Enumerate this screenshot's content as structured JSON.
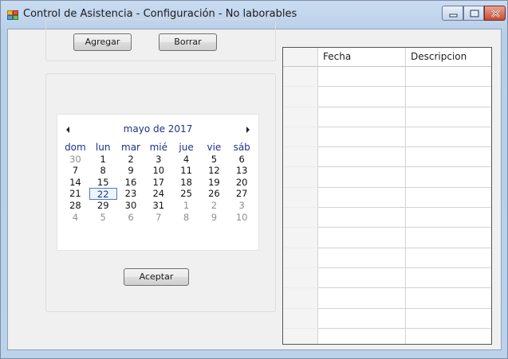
{
  "window": {
    "title": "Control de Asistencia - Configuración - No laborables",
    "icon": "form-icon",
    "controls": [
      "minimize-icon",
      "maximize-icon",
      "close-icon"
    ]
  },
  "toolbar": {
    "add_label": "Agregar",
    "delete_label": "Borrar"
  },
  "calendar": {
    "month_title": "mayo de 2017",
    "days_of_week": [
      "dom",
      "lun",
      "mar",
      "mié",
      "jue",
      "vie",
      "sáb"
    ],
    "weeks": [
      [
        {
          "d": "30",
          "other": true
        },
        {
          "d": "1"
        },
        {
          "d": "2"
        },
        {
          "d": "3"
        },
        {
          "d": "4"
        },
        {
          "d": "5"
        },
        {
          "d": "6"
        }
      ],
      [
        {
          "d": "7"
        },
        {
          "d": "8"
        },
        {
          "d": "9"
        },
        {
          "d": "10"
        },
        {
          "d": "11"
        },
        {
          "d": "12"
        },
        {
          "d": "13"
        }
      ],
      [
        {
          "d": "14"
        },
        {
          "d": "15"
        },
        {
          "d": "16"
        },
        {
          "d": "17"
        },
        {
          "d": "18"
        },
        {
          "d": "19"
        },
        {
          "d": "20"
        }
      ],
      [
        {
          "d": "21"
        },
        {
          "d": "22",
          "today": true
        },
        {
          "d": "23"
        },
        {
          "d": "24"
        },
        {
          "d": "25"
        },
        {
          "d": "26"
        },
        {
          "d": "27"
        }
      ],
      [
        {
          "d": "28"
        },
        {
          "d": "29"
        },
        {
          "d": "30"
        },
        {
          "d": "31"
        },
        {
          "d": "1",
          "other": true
        },
        {
          "d": "2",
          "other": true
        },
        {
          "d": "3",
          "other": true
        }
      ],
      [
        {
          "d": "4",
          "other": true
        },
        {
          "d": "5",
          "other": true
        },
        {
          "d": "6",
          "other": true
        },
        {
          "d": "7",
          "other": true
        },
        {
          "d": "8",
          "other": true
        },
        {
          "d": "9",
          "other": true
        },
        {
          "d": "10",
          "other": true
        }
      ]
    ],
    "today_day": "22",
    "accept_label": "Aceptar"
  },
  "grid": {
    "columns": [
      "Fecha",
      "Descripcion"
    ],
    "rows": [
      [
        "",
        ""
      ],
      [
        "",
        ""
      ],
      [
        "",
        ""
      ],
      [
        "",
        ""
      ],
      [
        "",
        ""
      ],
      [
        "",
        ""
      ],
      [
        "",
        ""
      ],
      [
        "",
        ""
      ],
      [
        "",
        ""
      ],
      [
        "",
        ""
      ],
      [
        "",
        ""
      ],
      [
        "",
        ""
      ],
      [
        "",
        ""
      ],
      [
        "",
        ""
      ]
    ]
  },
  "colors": {
    "titlebar": "#c9dcf1",
    "client_bg": "#f0f0f0",
    "calendar_accent": "#1e3287",
    "today_border": "#4c7ccc"
  }
}
